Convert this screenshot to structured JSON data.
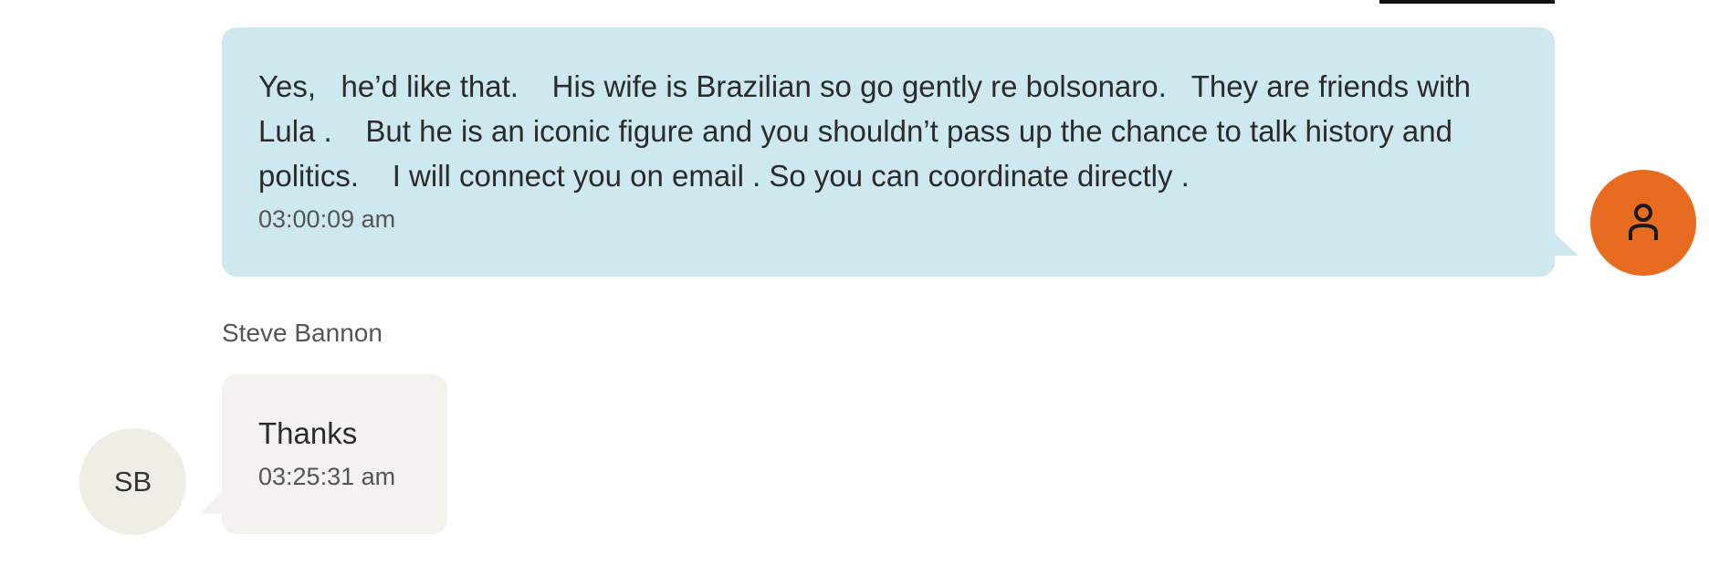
{
  "messages": {
    "outgoing": {
      "text": "Yes,   he’d like that.    His wife is Brazilian so go gently re bolsonaro.   They are friends with Lula .    But he is an iconic figure and you shouldn’t pass up the chance to talk history and politics.    I will connect you on email . So you can coordinate directly .",
      "time": "03:00:09 am",
      "avatar_icon": "person-icon",
      "avatar_color": "#e86c1f",
      "bubble_color": "#cde8ef"
    },
    "incoming": {
      "sender": "Steve Bannon",
      "text": "Thanks",
      "time": "03:25:31 am",
      "avatar_initials": "SB",
      "bubble_color": "#f3f2ee"
    }
  }
}
